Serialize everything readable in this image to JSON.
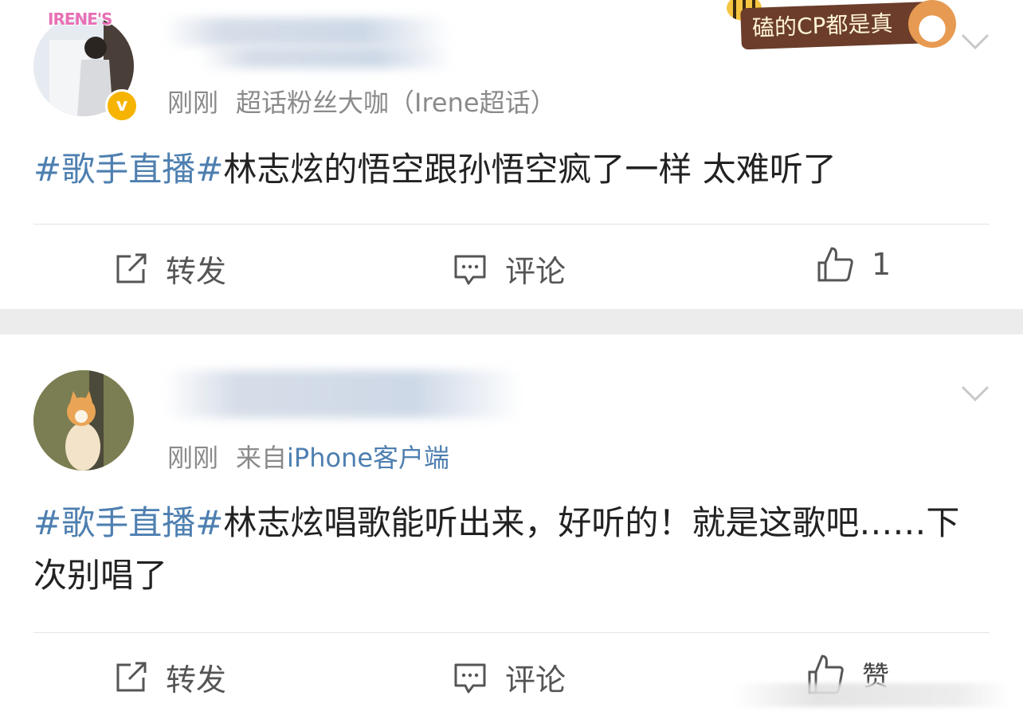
{
  "posts": [
    {
      "avatar_logo_text": "IRENE'S",
      "verified_badge": "v",
      "time": "刚刚",
      "source": "超话粉丝大咖（Irene超话）",
      "hashtag": "#歌手直播#",
      "text": "林志炫的悟空跟孙悟空疯了一样 太难听了",
      "actions": {
        "repost": "转发",
        "comment": "评论",
        "like": "1"
      },
      "sticker_text": "磕的CP都是真"
    },
    {
      "time": "刚刚",
      "source_prefix": "来自",
      "source_link": "iPhone客户端",
      "hashtag": "#歌手直播#",
      "text": "林志炫唱歌能听出来，好听的！就是这歌吧……下次别唱了",
      "actions": {
        "repost": "转发",
        "comment": "评论",
        "like": "赞"
      }
    }
  ],
  "icons": {
    "repost": "share-edit-icon",
    "comment": "comment-bubble-icon",
    "like": "thumbs-up-icon",
    "more": "chevron-down-icon"
  },
  "colors": {
    "link": "#4e7fb0",
    "meta": "#8a8a8a",
    "separator": "#ececec",
    "badge": "#f6b400"
  }
}
